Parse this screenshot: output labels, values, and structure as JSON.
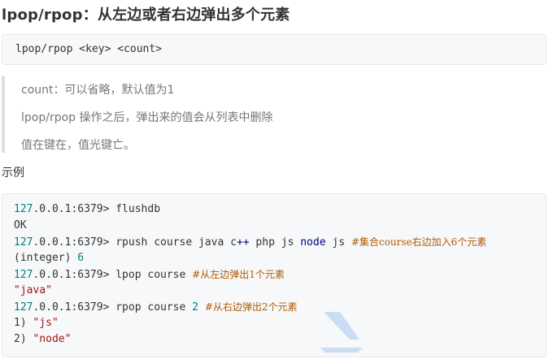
{
  "heading": "lpop/rpop：从左边或者右边弹出多个元素",
  "syntax": "lpop/rpop <key> <count>",
  "notes": [
    "count：可以省略，默认值为1",
    "lpop/rpop 操作之后，弹出来的值会从列表中删除",
    "值在键在，值光键亡。"
  ],
  "example_label": "示例",
  "code": {
    "prompt_num": "127",
    "prompt_rest": ".0.0.1:6379> ",
    "l1_cmd": "flushdb",
    "l2": "OK",
    "l3_a": "rpush course java c",
    "l3_b": "++",
    "l3_c": " php js ",
    "l3_d": "node",
    "l3_e": " js ",
    "l3_f": "#集合course右边加入6个元素",
    "l4_a": "(integer) ",
    "l4_b": "6",
    "l5_a": "lpop course ",
    "l5_b": "#从左边弹出1个元素",
    "l6": "\"java\"",
    "l7_a": "rpop course ",
    "l7_b": "2",
    "l7_c": " ",
    "l7_d": "#从右边弹出2个元素",
    "l8_a": "1) ",
    "l8_b": "\"js\"",
    "l9_a": "2) ",
    "l9_b": "\"node\""
  },
  "colors": {
    "number": "#008080",
    "keyword": "#000080",
    "string": "#a31515",
    "comment": "#b25a00"
  },
  "icons": [
    "watermark-logo-icon"
  ]
}
